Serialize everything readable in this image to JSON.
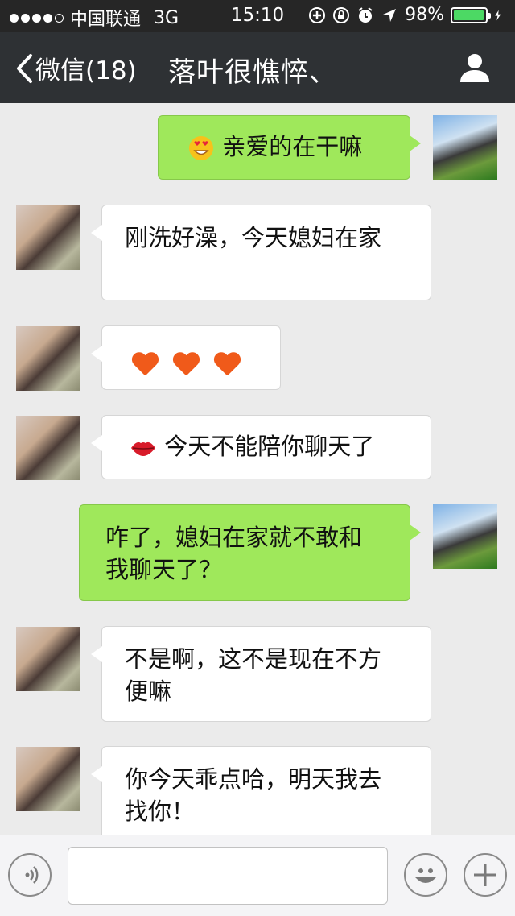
{
  "status_bar": {
    "carrier": "中国联通",
    "network": "3G",
    "time": "15:10",
    "battery_percent": "98%",
    "battery_level": 0.98,
    "battery_color": "#4cd964"
  },
  "nav": {
    "back_label": "微信(18)",
    "title": "落叶很憔悴、",
    "profile_icon": "person-icon"
  },
  "messages": [
    {
      "sender": "me",
      "emoji": "heart-eyes-emoji",
      "text": "亲爱的在干嘛"
    },
    {
      "sender": "other",
      "text": "刚洗好澡，今天媳妇在家"
    },
    {
      "sender": "other",
      "emoji": "three-hearts",
      "text": ""
    },
    {
      "sender": "other",
      "emoji": "lips-emoji",
      "text": "今天不能陪你聊天了"
    },
    {
      "sender": "me",
      "text_line1": "咋了，媳妇在家就不敢和",
      "text_line2": "我聊天了？"
    },
    {
      "sender": "other",
      "text_line1": "不是啊，这不是现在不方",
      "text_line2": "便嘛"
    },
    {
      "sender": "other",
      "text_line1": "你今天乖点哈，明天我去",
      "text_line2": "找你！"
    }
  ],
  "input_bar": {
    "voice_icon": "voice-icon",
    "emoji_icon": "smiley-icon",
    "add_icon": "plus-icon",
    "text_value": ""
  },
  "colors": {
    "outgoing_bubble": "#9fe85b",
    "incoming_bubble": "#ffffff",
    "nav_background": "#2e3134",
    "chat_background": "#ebebeb"
  }
}
